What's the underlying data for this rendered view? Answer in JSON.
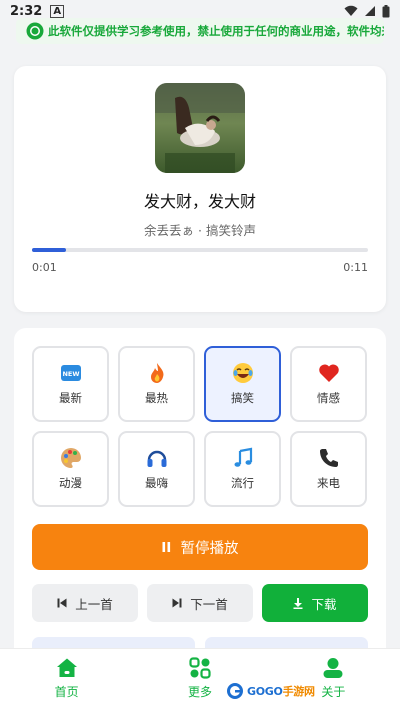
{
  "status_bar": {
    "time": "2:32",
    "badge": "A"
  },
  "notice": {
    "text": "此软件仅提供学习参考使用，禁止使用于任何的商业用途，软件均来",
    "icon": "info-circle-icon"
  },
  "player": {
    "title": "发大财，发大财",
    "artist": "余丢丢ぁ",
    "separator": " · ",
    "category": "搞笑铃声",
    "progress_fraction": 0.1,
    "time_current": "0:01",
    "time_total": "0:11"
  },
  "categories": [
    {
      "label": "最新",
      "icon": "new-badge-icon",
      "active": false
    },
    {
      "label": "最热",
      "icon": "fire-icon",
      "active": false
    },
    {
      "label": "搞笑",
      "icon": "laughing-face-icon",
      "active": true
    },
    {
      "label": "情感",
      "icon": "heart-icon",
      "active": false
    },
    {
      "label": "动漫",
      "icon": "palette-icon",
      "active": false
    },
    {
      "label": "最嗨",
      "icon": "headphones-icon",
      "active": false
    },
    {
      "label": "流行",
      "icon": "music-note-icon",
      "active": false
    },
    {
      "label": "来电",
      "icon": "phone-icon",
      "active": false
    }
  ],
  "controls": {
    "pause_label": "暂停播放",
    "prev_label": "上一首",
    "next_label": "下一首",
    "download_label": "下载"
  },
  "bottom_nav": [
    {
      "label": "首页",
      "icon": "home-icon"
    },
    {
      "label": "更多",
      "icon": "grid-more-icon"
    },
    {
      "label": "关于",
      "icon": "user-icon"
    }
  ],
  "watermark": {
    "text_a": "GOGO",
    "text_b": "手游网"
  },
  "colors": {
    "accent": "#2f5fd8",
    "pause": "#f7830f",
    "download": "#11b03a",
    "nav": "#14b344",
    "notice_text": "#18a83a"
  }
}
